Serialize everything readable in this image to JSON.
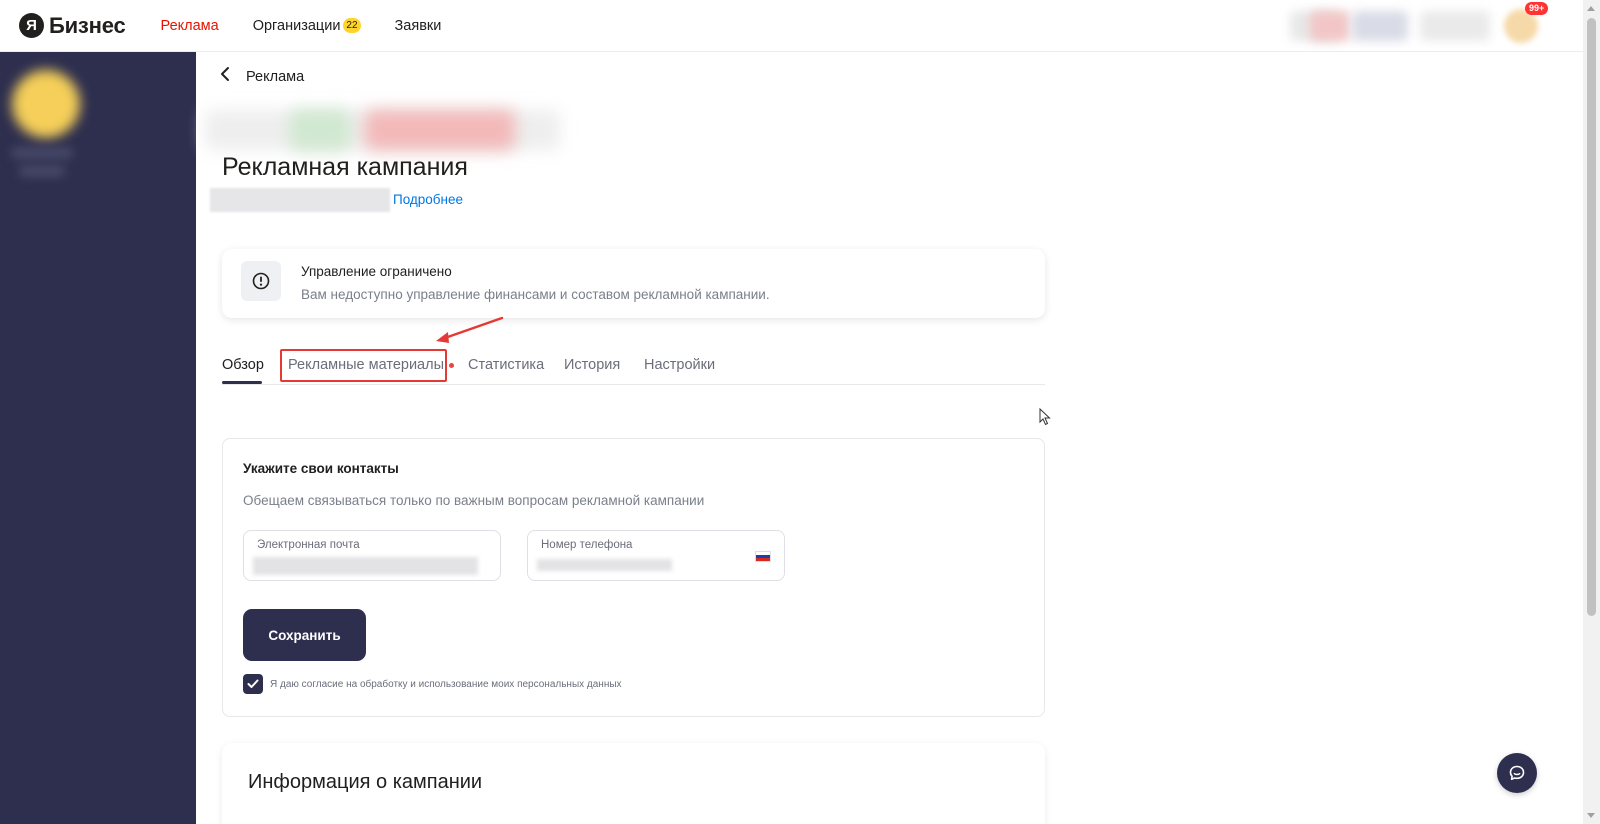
{
  "brand": {
    "logo_letter": "Я",
    "logo_text": "Бизнес"
  },
  "topnav": {
    "items": [
      {
        "label": "Реклама",
        "active": true
      },
      {
        "label": "Организации",
        "badge": "22"
      },
      {
        "label": "Заявки"
      }
    ],
    "notifications_badge": "99+"
  },
  "breadcrumb": {
    "back_label": "Реклама"
  },
  "page": {
    "title": "Рекламная кампания",
    "more_link": "Подробнее"
  },
  "notice": {
    "title": "Управление ограничено",
    "text": "Вам недоступно управление финансами и составом рекламной кампании."
  },
  "tabs": [
    {
      "label": "Обзор",
      "active": true
    },
    {
      "label": "Рекламные материалы",
      "has_dot": true,
      "highlighted": true
    },
    {
      "label": "Статистика"
    },
    {
      "label": "История"
    },
    {
      "label": "Настройки"
    }
  ],
  "contacts": {
    "title": "Укажите свои контакты",
    "subtitle": "Обещаем связываться только по важным вопросам рекламной кампании",
    "email_label": "Электронная почта",
    "phone_label": "Номер телефона",
    "save_label": "Сохранить",
    "consent_text": "Я даю согласие на обработку и использование моих персональных данных",
    "consent_checked": true
  },
  "info": {
    "title": "Информация о кампании"
  },
  "colors": {
    "accent_red": "#e61400",
    "sidebar": "#2e2f4f",
    "link": "#0077e6",
    "badge_yellow": "#fed42b"
  }
}
